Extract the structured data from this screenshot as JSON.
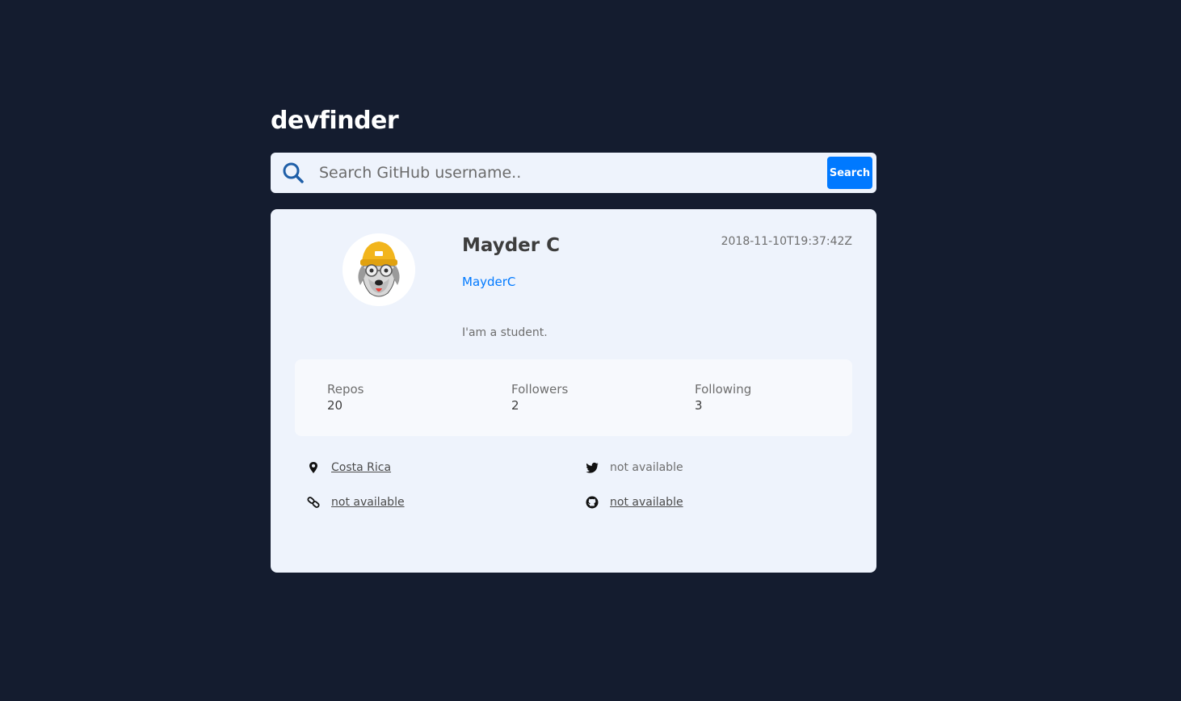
{
  "app": {
    "logo": "devfinder"
  },
  "search": {
    "placeholder": "Search GitHub username..",
    "button_label": "Search"
  },
  "profile": {
    "name": "Mayder C",
    "login": "MayderC",
    "joined": "2018-11-10T19:37:42Z",
    "bio": "I'am a student.",
    "avatar_icon": "dog-avatar-icon"
  },
  "stats": {
    "repos": {
      "label": "Repos",
      "value": "20"
    },
    "followers": {
      "label": "Followers",
      "value": "2"
    },
    "following": {
      "label": "Following",
      "value": "3"
    }
  },
  "links": {
    "location": {
      "text": "Costa Rica",
      "icon": "location-pin-icon"
    },
    "twitter": {
      "text": "not available",
      "icon": "twitter-icon"
    },
    "blog": {
      "text": "not available",
      "icon": "link-icon"
    },
    "company": {
      "text": "not available",
      "icon": "github-icon"
    }
  },
  "colors": {
    "background": "#141c2f",
    "card": "#eef3fc",
    "accent": "#0079ff"
  }
}
